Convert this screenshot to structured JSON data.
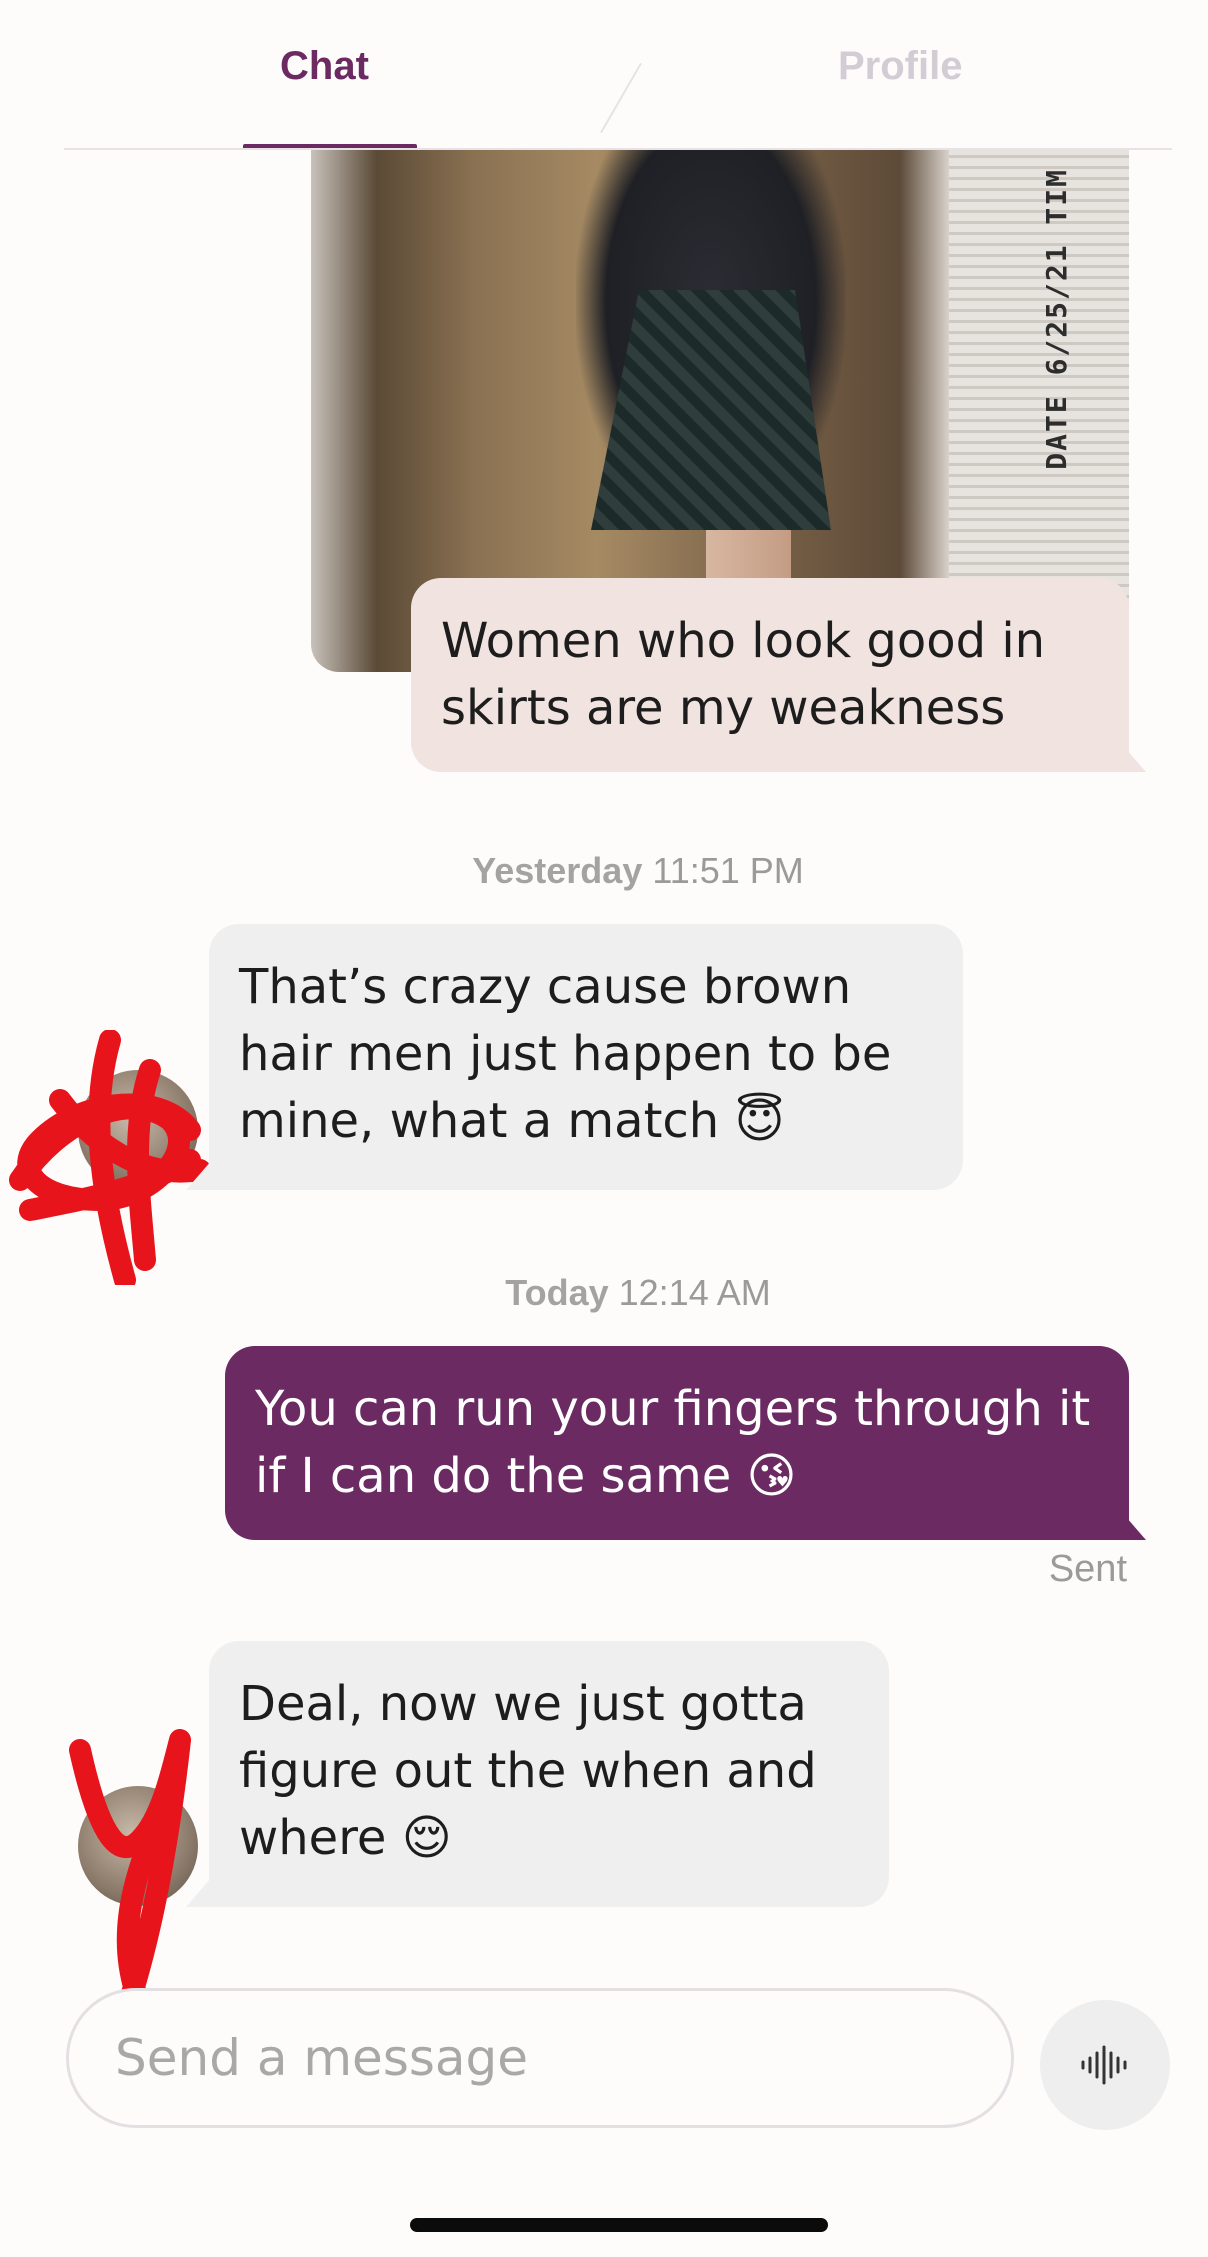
{
  "tabs": [
    {
      "label": "Chat",
      "active": true
    },
    {
      "label": "Profile",
      "active": false
    }
  ],
  "photo": {
    "stamp_text": "DATE 6/25/21 TIM"
  },
  "messages": [
    {
      "direction": "outgoing",
      "text": "Women who look good in skirts are my weakness"
    },
    {
      "direction": "incoming",
      "text": "That’s crazy cause brown hair men just happen to be mine, what a match",
      "emoji": "😇"
    },
    {
      "direction": "outgoing",
      "text": "You can run your fingers through it if I can do the same",
      "emoji": "😘",
      "status": "Sent"
    },
    {
      "direction": "incoming",
      "text": "Deal, now we just gotta figure out the when and where",
      "emoji": "😌"
    }
  ],
  "timestamps": [
    {
      "day": "Yesterday",
      "time": "11:51 PM"
    },
    {
      "day": "Today",
      "time": "12:14 AM"
    }
  ],
  "composer": {
    "placeholder": "Send a message",
    "voice_icon": "voice-waveform-icon"
  },
  "colors": {
    "accent": "#6b2a62",
    "outgoing_light": "#f1e3df",
    "incoming": "#efefef",
    "scribble": "#e8141b"
  }
}
